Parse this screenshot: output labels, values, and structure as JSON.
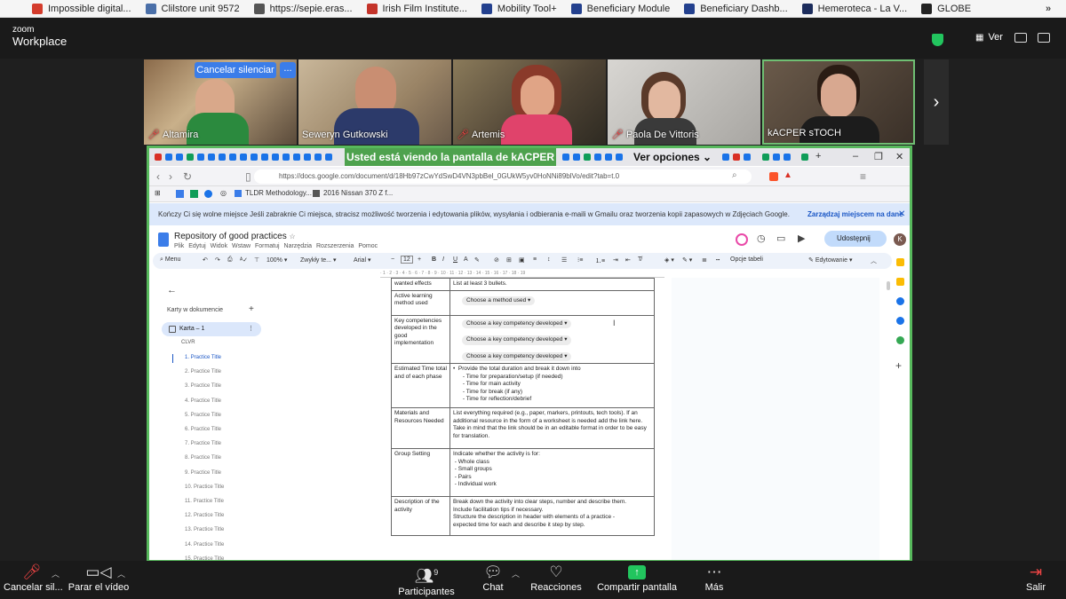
{
  "bookmarks": [
    {
      "label": "Impossible digital...",
      "color": "#d43c2c",
      "icon": "lse-favicon"
    },
    {
      "label": "Clilstore unit 9572",
      "color": "#4a6fa8",
      "icon": "clilstore-favicon"
    },
    {
      "label": "https://sepie.eras...",
      "color": "#555555",
      "icon": "globe-favicon"
    },
    {
      "label": "Irish Film Institute...",
      "color": "#c4342a",
      "icon": "ifi-favicon"
    },
    {
      "label": "Mobility Tool+",
      "color": "#23408e",
      "icon": "eu-flag-favicon"
    },
    {
      "label": "Beneficiary Module",
      "color": "#23408e",
      "icon": "eu-flag-favicon"
    },
    {
      "label": "Beneficiary Dashb...",
      "color": "#23408e",
      "icon": "eu-flag-favicon"
    },
    {
      "label": "Hemeroteca - La V...",
      "color": "#1c2c5c",
      "icon": "v-favicon"
    },
    {
      "label": "GLOBE",
      "color": "#222222",
      "icon": "globe-favicon"
    }
  ],
  "zoom": {
    "logo_top": "zoom",
    "logo_bottom": "Workplace",
    "view_label": "Ver",
    "unmute_button": "Cancelar silenciar",
    "more_button": "...",
    "participants": [
      {
        "name": "Altamira",
        "muted": true
      },
      {
        "name": "Seweryn Gutkowski",
        "muted": false
      },
      {
        "name": "Artemis",
        "muted": true
      },
      {
        "name": "Paola De Vittoris",
        "muted": true
      },
      {
        "name": "kACPER sTOCH",
        "muted": false
      }
    ],
    "share_banner": "Usted está viendo la pantalla de  kACPER sTOCH",
    "view_options": "Ver opciones"
  },
  "browser": {
    "url": "https://docs.google.com/document/d/18Hb97zCwYdSwD4VN3pbBel_0GUkW5yv0HoNNi89blVo/edit?tab=t.0",
    "bookmarks": [
      "TLDR Methodology...",
      "2016 Nissan 370 Z f..."
    ],
    "notice": "Kończy Ci się wolne miejsce  Jeśli zabraknie Ci miejsca, stracisz możliwość tworzenia i edytowania plików, wysyłania i odbierania e-maili w Gmailu oraz tworzenia kopii zapasowych w Zdjęciach Google.",
    "notice_link": "Zarządzaj miejscem na dane"
  },
  "doc": {
    "title": "Repository of good practices",
    "menu": "Plik Edytuj Widok Wstaw Formatuj Narzędzia Rozszerzenia Pomoc",
    "share": "Udostępnij",
    "avatar": "K",
    "toolbar": {
      "search": "Menu",
      "zoom": "100%",
      "style": "Zwykły te...",
      "font": "Arial",
      "size": "12",
      "image_options": "Opcje tabeli",
      "mode": "Edytowanie"
    },
    "outline": {
      "heading": "Karty w dokumencie",
      "tab": "Karta – 1",
      "section": "CLVR",
      "items": [
        "1. Practice Title",
        "2. Practice Title",
        "3. Practice Title",
        "4. Practice Title",
        "5. Practice Title",
        "6. Practice Title",
        "7. Practice Title",
        "8. Practice Title",
        "9. Practice Title",
        "10. Practice Title",
        "11. Practice Title",
        "12. Practice Title",
        "13. Practice Title",
        "14. Practice Title",
        "15. Practice Title"
      ]
    },
    "table": {
      "r0": {
        "label": "wanted effects",
        "content": "List at least 3 bullets."
      },
      "r1": {
        "label": "Active learning method used",
        "chip": "Choose a method used"
      },
      "r2": {
        "label": "Key competencies developed in the good implementation",
        "chips": [
          "Choose a key competency developed",
          "Choose a key competency developed",
          "Choose a key competency developed"
        ]
      },
      "r3": {
        "label": "Estimated Time total and of each phase",
        "lines": [
          "•  Provide the total duration and break it down into",
          "      - Time for preparation/setup (if needed)",
          "      - Time for main activity",
          "      - Time for break (if any)",
          "      - Time for reflection/debrief"
        ]
      },
      "r4": {
        "label": "Materials and Resources Needed",
        "content": "List everything required (e.g., paper, markers, printouts, tech tools). If an additional resource in the form of a worksheet is needed add the link here. Take in mind that the link should be in an editable format in order to be easy for translation."
      },
      "r5": {
        "label": "Group Setting",
        "lines": [
          "Indicate whether the activity is for:",
          " - Whole class",
          " - Small groups",
          " - Pairs",
          " - Individual work"
        ]
      },
      "r6": {
        "label": "Description of the activity",
        "lines": [
          "Break down the activity into clear steps, number and describe them.",
          "Include facilitation tips if necessary.",
          "Structure the description in header with elements of a practice -",
          "expected time for each and describe it step by step."
        ]
      }
    }
  },
  "controls": {
    "unmute": "Cancelar sil...",
    "video": "Parar el vídeo",
    "participants": "Participantes",
    "participants_count": "9",
    "chat": "Chat",
    "reactions": "Reacciones",
    "share": "Compartir pantalla",
    "more": "Más",
    "leave": "Salir"
  }
}
